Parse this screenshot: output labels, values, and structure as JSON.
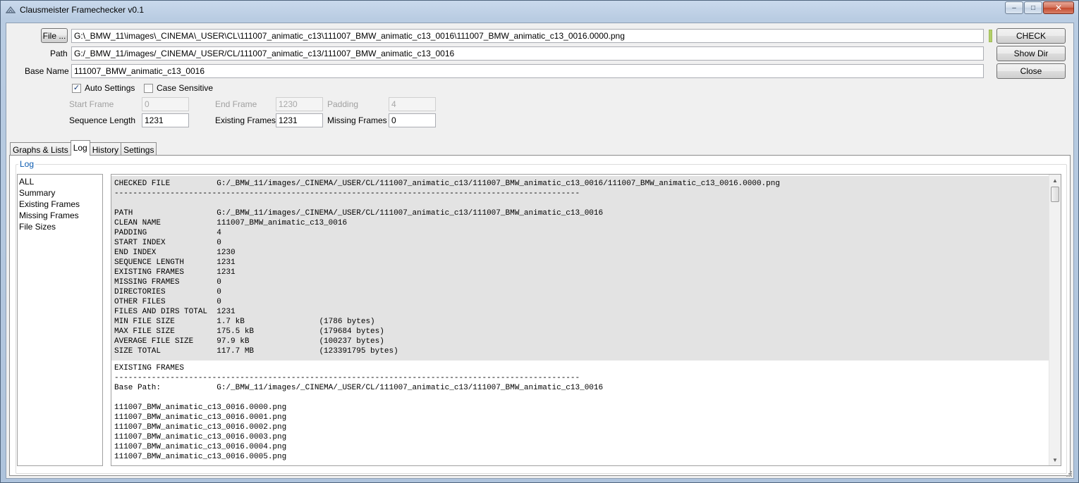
{
  "window": {
    "title": "Clausmeister Framechecker v0.1",
    "controls": {
      "minimize": "–",
      "maximize": "□",
      "close": "✕"
    }
  },
  "form": {
    "file_button": "File ...",
    "file_value": "G:\\_BMW_11\\images\\_CINEMA\\_USER\\CL\\111007_animatic_c13\\111007_BMW_animatic_c13_0016\\111007_BMW_animatic_c13_0016.0000.png",
    "path_label": "Path",
    "path_value": "G:/_BMW_11/images/_CINEMA/_USER/CL/111007_animatic_c13/111007_BMW_animatic_c13_0016",
    "base_name_label": "Base Name",
    "base_name_value": "111007_BMW_animatic_c13_0016",
    "check_button": "CHECK",
    "show_dir_button": "Show Dir",
    "close_button": "Close",
    "auto_settings_label": "Auto Settings",
    "auto_settings_checked": true,
    "case_sensitive_label": "Case Sensitive",
    "case_sensitive_checked": false,
    "start_frame_label": "Start Frame",
    "start_frame_value": "0",
    "end_frame_label": "End Frame",
    "end_frame_value": "1230",
    "padding_label": "Padding",
    "padding_value": "4",
    "sequence_length_label": "Sequence Length",
    "sequence_length_value": "1231",
    "existing_frames_label": "Existing Frames",
    "existing_frames_value": "1231",
    "missing_frames_label": "Missing Frames",
    "missing_frames_value": "0"
  },
  "tabs": [
    {
      "label": "Graphs & Lists",
      "active": false
    },
    {
      "label": "Log",
      "active": true
    },
    {
      "label": "History",
      "active": false
    },
    {
      "label": "Settings",
      "active": false
    }
  ],
  "log_panel": {
    "group_title": "Log",
    "categories": [
      "ALL",
      "Summary",
      "Existing Frames",
      "Missing Frames",
      "File Sizes"
    ],
    "summary_lines": [
      "CHECKED FILE          G:/_BMW_11/images/_CINEMA/_USER/CL/111007_animatic_c13/111007_BMW_animatic_c13_0016/111007_BMW_animatic_c13_0016.0000.png",
      "----------------------------------------------------------------------------------------------------",
      "",
      "PATH                  G:/_BMW_11/images/_CINEMA/_USER/CL/111007_animatic_c13/111007_BMW_animatic_c13_0016",
      "CLEAN NAME            111007_BMW_animatic_c13_0016",
      "PADDING               4",
      "START INDEX           0",
      "END INDEX             1230",
      "SEQUENCE LENGTH       1231",
      "EXISTING FRAMES       1231",
      "MISSING FRAMES        0",
      "DIRECTORIES           0",
      "OTHER FILES           0",
      "FILES AND DIRS TOTAL  1231",
      "MIN FILE SIZE         1.7 kB                (1786 bytes)",
      "MAX FILE SIZE         175.5 kB              (179684 bytes)",
      "AVERAGE FILE SIZE     97.9 kB               (100237 bytes)",
      "SIZE TOTAL            117.7 MB              (123391795 bytes)"
    ],
    "existing_lines": [
      "EXISTING FRAMES",
      "----------------------------------------------------------------------------------------------------",
      "Base Path:            G:/_BMW_11/images/_CINEMA/_USER/CL/111007_animatic_c13/111007_BMW_animatic_c13_0016",
      "",
      "111007_BMW_animatic_c13_0016.0000.png",
      "111007_BMW_animatic_c13_0016.0001.png",
      "111007_BMW_animatic_c13_0016.0002.png",
      "111007_BMW_animatic_c13_0016.0003.png",
      "111007_BMW_animatic_c13_0016.0004.png",
      "111007_BMW_animatic_c13_0016.0005.png"
    ],
    "scroll_up": "▲",
    "scroll_down": "▼"
  },
  "icons": {
    "app": "app-icon",
    "checkmark": "✓"
  }
}
